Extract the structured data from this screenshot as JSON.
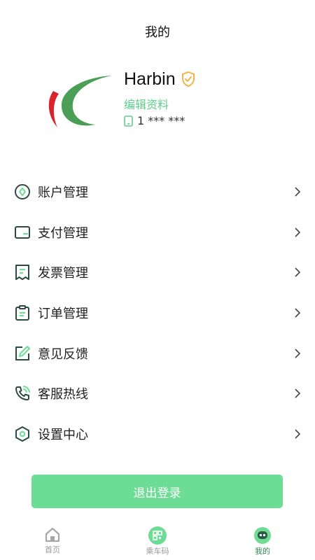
{
  "header": {
    "title": "我的"
  },
  "profile": {
    "username": "Harbin",
    "edit_label": "编辑资料",
    "phone": "1 ***  ***",
    "logo_icon": "brand-swoosh-logo",
    "verified_icon": "shield-check-icon"
  },
  "menu": {
    "items": [
      {
        "label": "账户管理",
        "icon": "account-icon"
      },
      {
        "label": "支付管理",
        "icon": "wallet-icon"
      },
      {
        "label": "发票管理",
        "icon": "invoice-icon"
      },
      {
        "label": "订单管理",
        "icon": "clipboard-icon"
      },
      {
        "label": "意见反馈",
        "icon": "feedback-edit-icon"
      },
      {
        "label": "客服热线",
        "icon": "phone-call-icon"
      },
      {
        "label": "设置中心",
        "icon": "settings-hexagon-icon"
      }
    ]
  },
  "logout": {
    "label": "退出登录"
  },
  "tabbar": {
    "tabs": [
      {
        "label": "首页",
        "icon": "home-icon",
        "active": false
      },
      {
        "label": "乘车码",
        "icon": "qr-code-icon",
        "active": false
      },
      {
        "label": "我的",
        "icon": "profile-robot-icon",
        "active": true
      }
    ]
  },
  "colors": {
    "accent": "#6ddc95",
    "accent_text": "#5fce8b",
    "icon_dark": "#2b4a40",
    "active_tab": "#2c8a55",
    "verified": "#f0b544",
    "logo_red": "#d8242a",
    "logo_green": "#4a9e55"
  }
}
